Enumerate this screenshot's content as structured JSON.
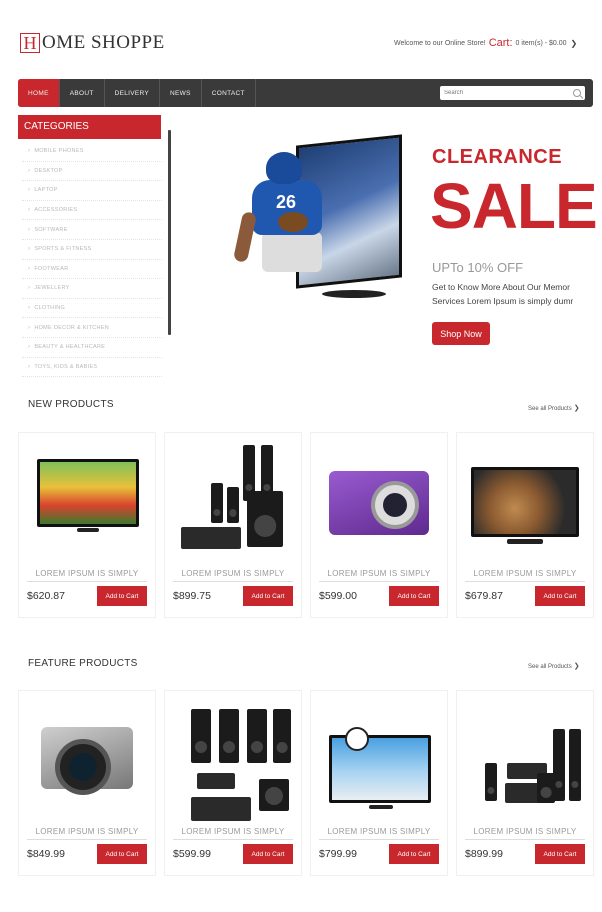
{
  "header": {
    "logo_letter": "H",
    "logo_text": "OME SHOPPE",
    "welcome_text": "Welcome to our Online Store!",
    "cart_label": "Cart:",
    "cart_summary": "0 item(s) - $0.00",
    "cart_chevron": "❯"
  },
  "nav": {
    "items": [
      "HOME",
      "ABOUT",
      "DELIVERY",
      "NEWS",
      "CONTACT"
    ],
    "search_placeholder": "Search"
  },
  "sidebar": {
    "title": "CATEGORIES",
    "items": [
      "MOBILE PHONES",
      "DESKTOP",
      "LAPTOP",
      "ACCESSORIES",
      "SOFTWARE",
      "SPORTS & FITNESS",
      "FOOTWEAR",
      "JEWELLERY",
      "CLOTHING",
      "HOME DECOR & KITCHEN",
      "BEAUTY & HEALTHCARE",
      "TOYS, KIDS & BABIES"
    ]
  },
  "banner": {
    "jersey_number": "26",
    "headline": "CLEARANCE",
    "sale": "SALE",
    "subheadline": "UPTo 10% OFF",
    "text_line1": "Get to Know More About Our Memor",
    "text_line2": "Services Lorem Ipsum is simply dumr",
    "button": "Shop Now"
  },
  "new_products": {
    "title": "NEW PRODUCTS",
    "see_all": "See all Products",
    "items": [
      {
        "name": "LOREM IPSUM IS SIMPLY",
        "price": "$620.87",
        "button": "Add to Cart",
        "icon": "flat-tv-flowers"
      },
      {
        "name": "LOREM IPSUM IS SIMPLY",
        "price": "$899.75",
        "button": "Add to Cart",
        "icon": "home-theater-speakers"
      },
      {
        "name": "LOREM IPSUM IS SIMPLY",
        "price": "$599.00",
        "button": "Add to Cart",
        "icon": "purple-compact-camera"
      },
      {
        "name": "LOREM IPSUM IS SIMPLY",
        "price": "$679.87",
        "button": "Add to Cart",
        "icon": "monitor-dome"
      }
    ]
  },
  "feature_products": {
    "title": "FEATURE PRODUCTS",
    "see_all": "See all Products",
    "items": [
      {
        "name": "LOREM IPSUM IS SIMPLY",
        "price": "$849.99",
        "button": "Add to Cart",
        "icon": "dslr-camera"
      },
      {
        "name": "LOREM IPSUM IS SIMPLY",
        "price": "$599.99",
        "button": "Add to Cart",
        "icon": "speaker-set"
      },
      {
        "name": "LOREM IPSUM IS SIMPLY",
        "price": "$799.99",
        "button": "Add to Cart",
        "icon": "tv-soccer"
      },
      {
        "name": "LOREM IPSUM IS SIMPLY",
        "price": "$899.99",
        "button": "Add to Cart",
        "icon": "home-theater-system"
      }
    ]
  },
  "colors": {
    "accent": "#c8282d",
    "nav_bg": "#3a3a3a"
  }
}
